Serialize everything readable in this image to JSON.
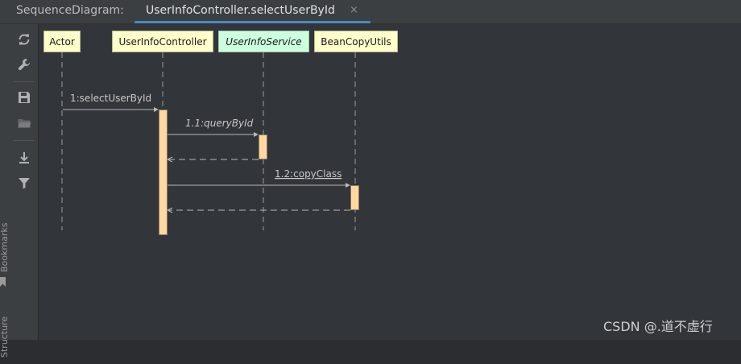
{
  "header": {
    "tool_title": "SequenceDiagram:",
    "tab_label": "UserInfoController.selectUserById",
    "tab_close": "×"
  },
  "toolbar": {
    "buttons": [
      "refresh-icon",
      "wrench-icon",
      "save-icon",
      "folder-icon",
      "export-icon",
      "filter-icon"
    ],
    "side_labels": [
      "Bookmarks",
      "Structure"
    ]
  },
  "diagram": {
    "participants": [
      {
        "name": "Actor",
        "kind": "actor"
      },
      {
        "name": "UserInfoController",
        "kind": "class"
      },
      {
        "name": "UserInfoService",
        "kind": "interface"
      },
      {
        "name": "BeanCopyUtils",
        "kind": "class"
      }
    ],
    "messages": [
      {
        "label": "1:selectUserById",
        "style": "normal"
      },
      {
        "label": "1.1:queryById",
        "style": "italic"
      },
      {
        "label": "1.2:copyClass",
        "style": "underline"
      }
    ]
  },
  "colors": {
    "background": "#32353a",
    "participant_class": "#ffffcc",
    "participant_interface": "#ccffdd",
    "activation_fill": "#ffd8a0",
    "arrow": "#b8b8b8",
    "tab_underline": "#4a88c7"
  },
  "watermark": "CSDN @.道不虚行"
}
